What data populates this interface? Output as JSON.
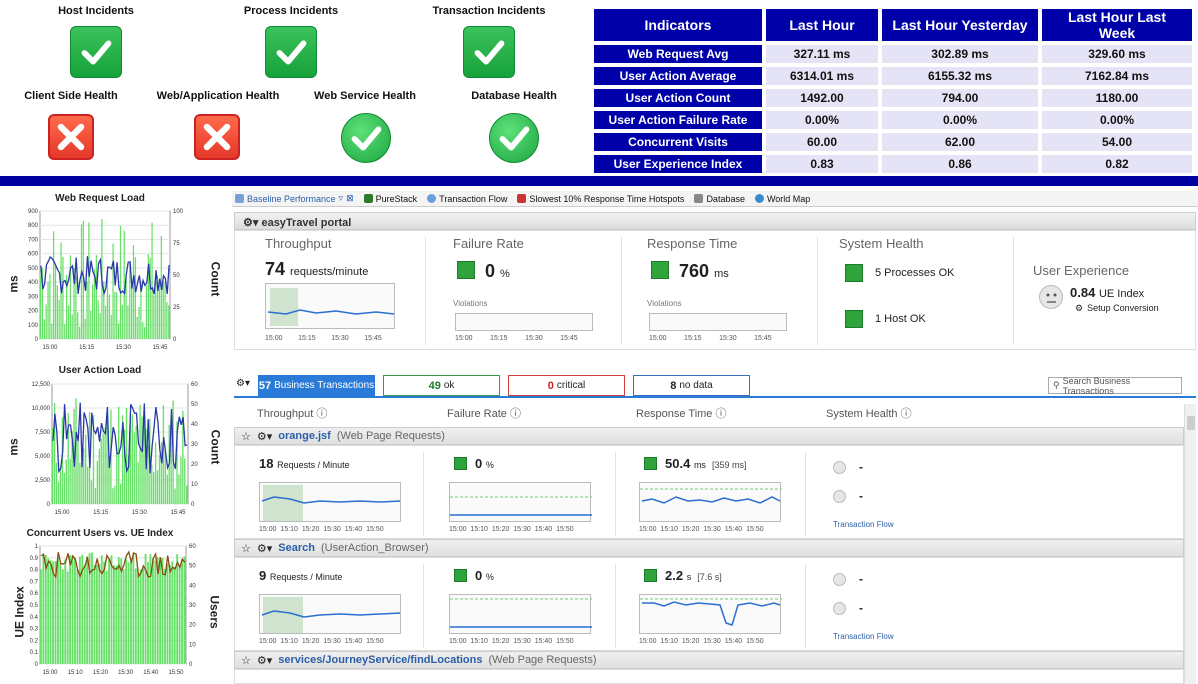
{
  "health": {
    "tiles": [
      {
        "label": "Host Incidents",
        "status": "ok"
      },
      {
        "label": "Process Incidents",
        "status": "ok"
      },
      {
        "label": "Transaction Incidents",
        "status": "ok"
      },
      {
        "label": "Client Side Health",
        "status": "fail"
      },
      {
        "label": "Web/Application Health",
        "status": "fail"
      },
      {
        "label": "Web Service Health",
        "status": "ok"
      },
      {
        "label": "Database Health",
        "status": "ok"
      }
    ]
  },
  "indicators": {
    "headers": [
      "Indicators",
      "Last Hour",
      "Last Hour Yesterday",
      "Last Hour Last Week"
    ],
    "rows": [
      [
        "Web Request Avg",
        "327.11 ms",
        "302.89 ms",
        "329.60 ms"
      ],
      [
        "User Action Average",
        "6314.01 ms",
        "6155.32 ms",
        "7162.84 ms"
      ],
      [
        "User Action Count",
        "1492.00",
        "794.00",
        "1180.00"
      ],
      [
        "User Action Failure Rate",
        "0.00%",
        "0.00%",
        "0.00%"
      ],
      [
        "Concurrent Visits",
        "60.00",
        "62.00",
        "54.00"
      ],
      [
        "User Experience Index",
        "0.83",
        "0.86",
        "0.82"
      ]
    ]
  },
  "left_charts": {
    "web_request": {
      "title": "Web Request Load",
      "ylabel": "ms",
      "y2label": "Count",
      "yticks": [
        "900",
        "800",
        "700",
        "600",
        "500",
        "400",
        "300",
        "200",
        "100",
        "0"
      ],
      "y2ticks": [
        "100",
        "75",
        "50",
        "25",
        "0"
      ],
      "xticks": [
        "15:00",
        "15:15",
        "15:30",
        "15:45"
      ]
    },
    "user_action": {
      "title": "User Action Load",
      "ylabel": "ms",
      "y2label": "Count",
      "yticks": [
        "12,500",
        "10,000",
        "7,500",
        "5,000",
        "2,500",
        "0"
      ],
      "y2ticks": [
        "60",
        "50",
        "40",
        "30",
        "20",
        "10",
        "0"
      ],
      "xticks": [
        "15:00",
        "15:15",
        "15:30",
        "15:45"
      ]
    },
    "concurrent": {
      "title": "Concurrent Users vs. UE Index",
      "ylabel": "UE Index",
      "y2label": "Users",
      "yticks": [
        "1",
        "0.9",
        "0.8",
        "0.7",
        "0.6",
        "0.5",
        "0.4",
        "0.3",
        "0.2",
        "0.1",
        "0"
      ],
      "y2ticks": [
        "60",
        "50",
        "40",
        "30",
        "20",
        "10",
        "0"
      ],
      "xticks": [
        "15:00",
        "15:10",
        "15:20",
        "15:30",
        "15:40",
        "15:50"
      ]
    }
  },
  "tabs": [
    "Baseline Performance",
    "PureStack",
    "Transaction Flow",
    "Slowest 10% Response Time Hotspots",
    "Database",
    "World Map"
  ],
  "portal": {
    "name": "easyTravel portal",
    "throughput_title": "Throughput",
    "throughput_value": "74",
    "throughput_unit": "requests/minute",
    "failure_title": "Failure Rate",
    "failure_value": "0",
    "failure_unit": "%",
    "response_title": "Response Time",
    "response_value": "760",
    "response_unit": "ms",
    "health_title": "System Health",
    "processes": "5 Processes OK",
    "hosts": "1 Host OK",
    "ux_title": "User Experience",
    "ux_value": "0.84",
    "ux_unit": "UE Index",
    "setup": "Setup Conversion",
    "violations": "Violations",
    "xticks": [
      "15:00",
      "15:15",
      "15:30",
      "15:45"
    ]
  },
  "bt": {
    "total_count": "57",
    "total_label": "Business Transactions",
    "ok_count": "49",
    "ok_label": "ok",
    "crit_count": "0",
    "crit_label": "critical",
    "nodata_count": "8",
    "nodata_label": "no data",
    "search_placeholder": "Search Business Transactions",
    "col_headers": [
      "Throughput",
      "Failure Rate",
      "Response Time",
      "System Health"
    ],
    "xticks": [
      "15:00",
      "15:10",
      "15:20",
      "15:30",
      "15:40",
      "15:50"
    ],
    "transaction_flow": "Transaction Flow",
    "rows": [
      {
        "name": "orange.jsf",
        "type": "(Web Page Requests)",
        "tp_value": "18",
        "tp_unit": "Requests / Minute",
        "fr_value": "0",
        "fr_unit": "%",
        "rt_value": "50.4",
        "rt_unit": "ms",
        "rt_bracket": "[359 ms]",
        "health": [
          "-",
          "-"
        ]
      },
      {
        "name": "Search",
        "type": "(UserAction_Browser)",
        "tp_value": "9",
        "tp_unit": "Requests / Minute",
        "fr_value": "0",
        "fr_unit": "%",
        "rt_value": "2.2",
        "rt_unit": "s",
        "rt_bracket": "[7.6 s]",
        "health": [
          "-",
          "-"
        ]
      },
      {
        "name": "services/JourneyService/findLocations",
        "type": "(Web Page Requests)"
      }
    ]
  },
  "colors": {
    "navy": "#0000a8",
    "green": "#2fa33c",
    "line": "#2a37a8",
    "bar": "#66e066"
  }
}
